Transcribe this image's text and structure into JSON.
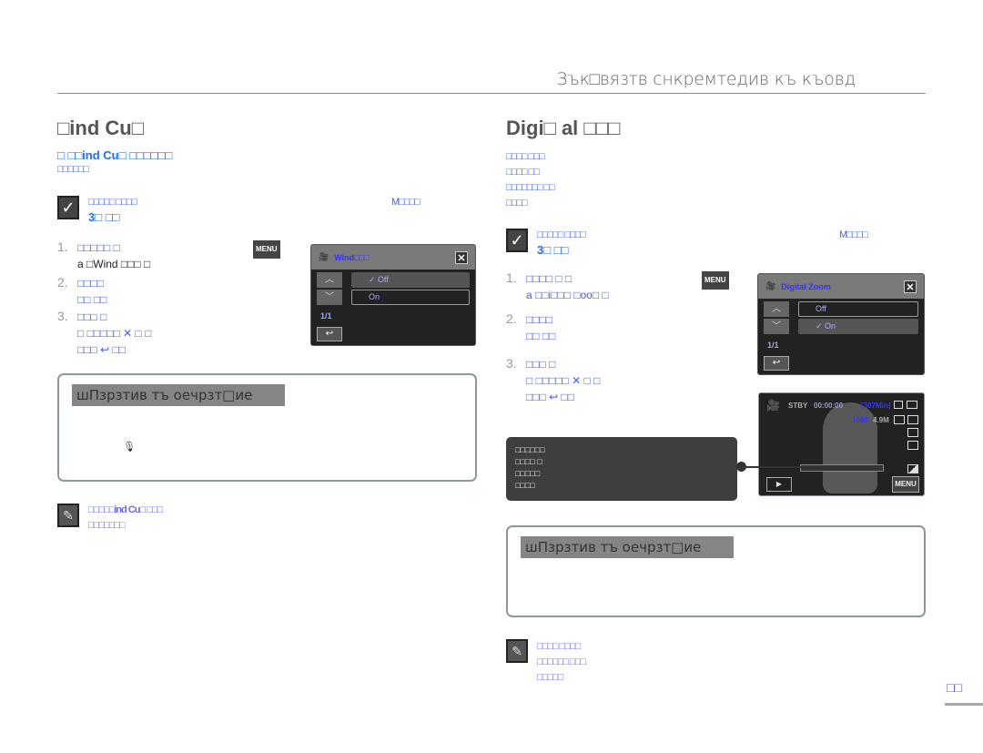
{
  "header": {
    "title": "Зък□вязтв снкремтедив къ къовд"
  },
  "left": {
    "title": "□ind Cu□",
    "intro": [
      "□ □□ind Cu□ □□□□□□",
      "□□□□□□"
    ],
    "check": [
      "□□□□□ □□□□",
      "M□□□□",
      "3□ □□"
    ],
    "steps": [
      {
        "n": "1.",
        "lines": [
          "□□□□□ □",
          "a □Wind □□□  □"
        ],
        "menu": "MENU"
      },
      {
        "n": "2.",
        "lines": [
          "□□□□",
          "□□     □□"
        ]
      },
      {
        "n": "3.",
        "lines": [
          "□□□ □",
          "□ □□□□□  ✕ □ □",
          "□□□   ↩ □□"
        ]
      }
    ],
    "screen": {
      "title": "Wind□□□",
      "options": [
        "Off",
        "On"
      ],
      "page": "1/1"
    },
    "tip_title": "шПзрзтив тъ оечрзт□ие",
    "note": [
      "□□□□□ind Cu□ □□□",
      "□□□□□□□"
    ]
  },
  "right": {
    "title": "Digi□ al □□□",
    "intro": [
      "□□□□ □□□",
      "□□□□ □□",
      "□□□□□□□ □□",
      "□□□□"
    ],
    "check": [
      "□□□□□ □□□□",
      "M□□□□",
      "3□ □□"
    ],
    "steps": [
      {
        "n": "1.",
        "lines": [
          "□□□□ □ □",
          "a □□i□□□ □oo□   □"
        ],
        "menu": "MENU"
      },
      {
        "n": "2.",
        "lines": [
          "□□□□",
          "□□     □□"
        ]
      },
      {
        "n": "3.",
        "lines": [
          "□□□ □",
          "□ □□□□□  ✕ □ □",
          "□□□   ↩ □□"
        ]
      }
    ],
    "screen": {
      "title": "Digital Zoom",
      "options": [
        "Off",
        "On"
      ],
      "page": "1/1"
    },
    "live": {
      "status": "STBY",
      "time": "00:00:00",
      "remain": "[307Min]",
      "res": "1080",
      "mp": "4.9M",
      "menu": "MENU"
    },
    "callout": [
      "□□□□□□",
      "□□□□ □",
      "□□□□□",
      "□□□□"
    ],
    "tip_title": "шПзрзтив тъ оечрзт□ие",
    "note": [
      "□□□□ □□□□",
      "□□□□□□ □□□",
      "□□□□□"
    ]
  },
  "page_number": "□□"
}
